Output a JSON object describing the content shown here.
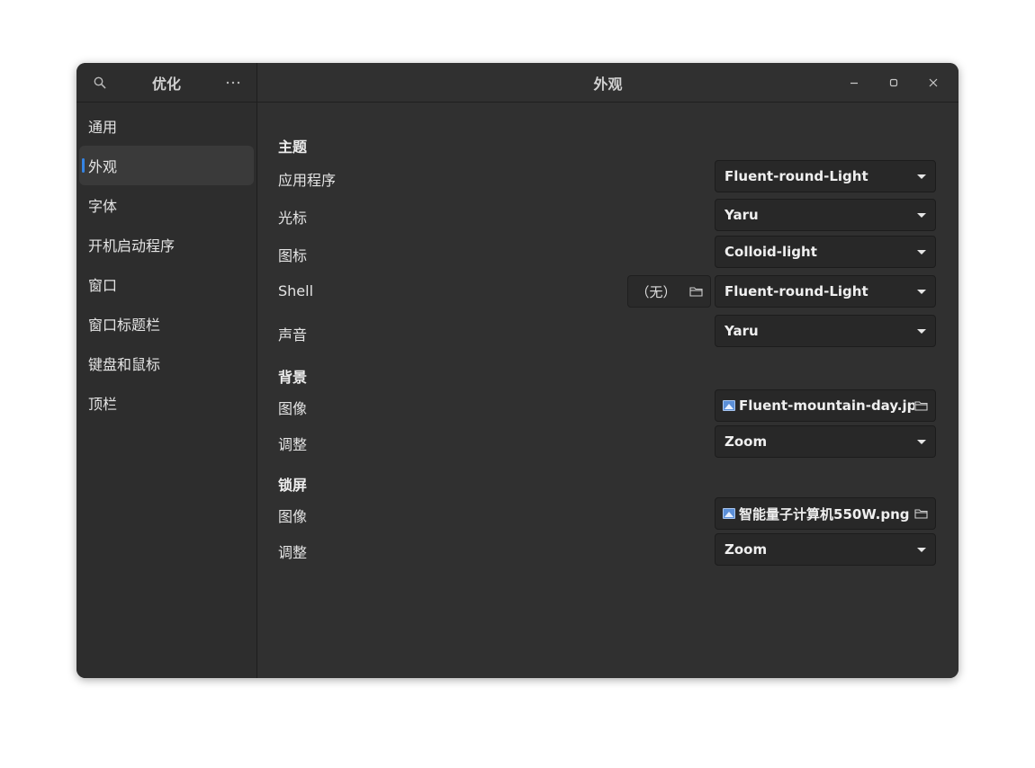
{
  "sidebar": {
    "title": "优化",
    "items": [
      {
        "label": "通用"
      },
      {
        "label": "外观"
      },
      {
        "label": "字体"
      },
      {
        "label": "开机启动程序"
      },
      {
        "label": "窗口"
      },
      {
        "label": "窗口标题栏"
      },
      {
        "label": "键盘和鼠标"
      },
      {
        "label": "顶栏"
      }
    ],
    "active_index": 1
  },
  "main": {
    "title": "外观",
    "sections": {
      "theme": {
        "title": "主题",
        "app_label": "应用程序",
        "app_value": "Fluent-round-Light",
        "cursor_label": "光标",
        "cursor_value": "Yaru",
        "icon_label": "图标",
        "icon_value": "Colloid-light",
        "shell_label": "Shell",
        "shell_none": "（无）",
        "shell_value": "Fluent-round-Light",
        "sound_label": "声音",
        "sound_value": "Yaru"
      },
      "background": {
        "title": "背景",
        "image_label": "图像",
        "image_value": "Fluent-mountain-day.jpg",
        "adjust_label": "调整",
        "adjust_value": "Zoom"
      },
      "lockscreen": {
        "title": "锁屏",
        "image_label": "图像",
        "image_value": "智能量子计算机550W.png",
        "adjust_label": "调整",
        "adjust_value": "Zoom"
      }
    }
  },
  "colors": {
    "accent": "#3584e4",
    "window_bg": "#2e2e2e",
    "dropdown_bg": "#282828"
  },
  "icons": [
    "search-icon",
    "more-icon",
    "minimize-icon",
    "maximize-icon",
    "close-icon",
    "folder-icon",
    "image-file-icon",
    "dropdown-arrow-icon"
  ]
}
